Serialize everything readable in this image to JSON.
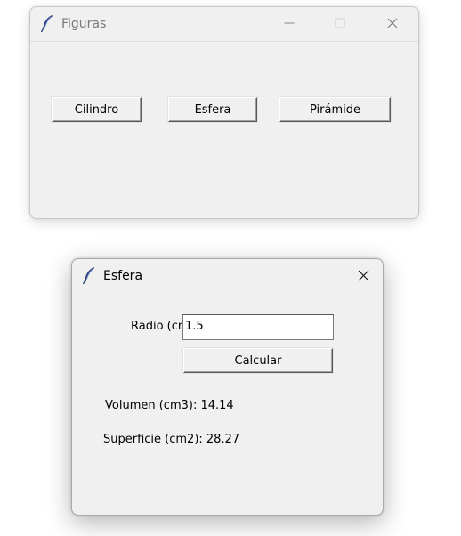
{
  "main_window": {
    "title": "Figuras",
    "icon": "feather-icon",
    "buttons": {
      "cilindro": "Cilindro",
      "esfera": "Esfera",
      "piramide": "Pirámide"
    }
  },
  "esfera_window": {
    "title": "Esfera",
    "icon": "feather-icon",
    "radio_label": "Radio (cm):",
    "radio_value": "1.5",
    "calcular": "Calcular",
    "volumen": "Volumen (cm3): 14.14",
    "superficie": "Superficie (cm2): 28.27"
  }
}
